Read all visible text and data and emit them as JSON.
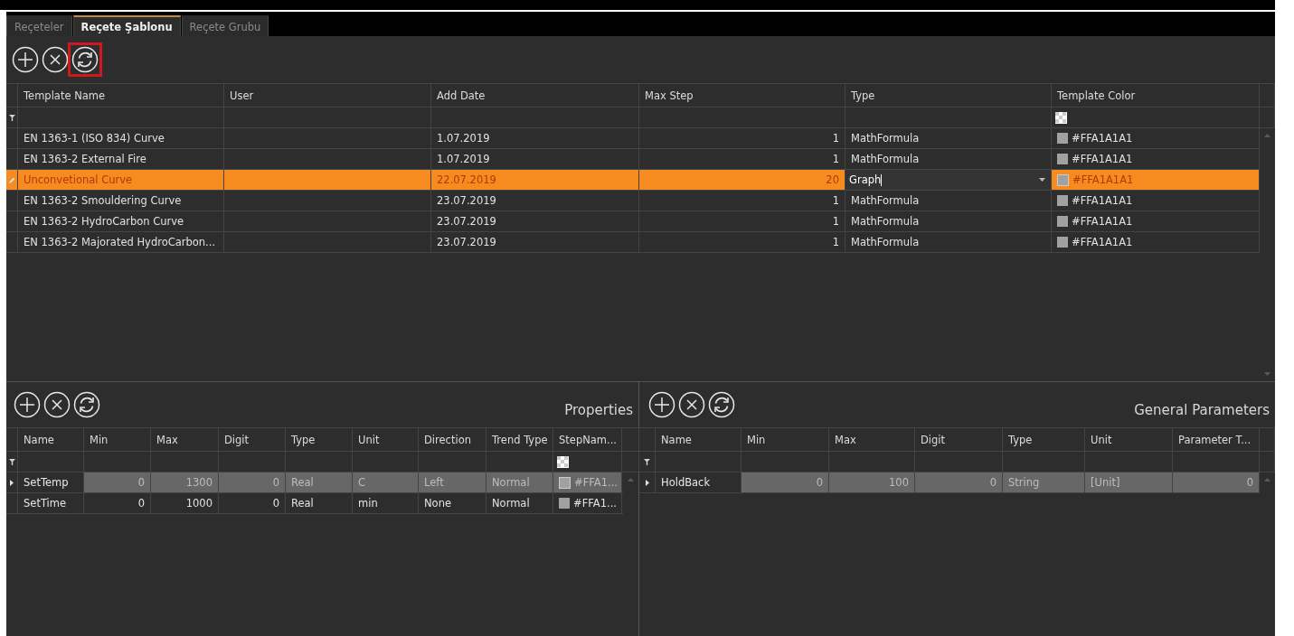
{
  "tabs": [
    {
      "label": "Reçeteler",
      "selected": false
    },
    {
      "label": "Reçete Şablonu",
      "selected": true
    },
    {
      "label": "Reçete Grubu",
      "selected": false
    }
  ],
  "toolbar": {
    "buttons": [
      {
        "kind": "add",
        "highlighted": false
      },
      {
        "kind": "remove",
        "highlighted": false
      },
      {
        "kind": "refresh",
        "highlighted": true
      }
    ]
  },
  "templates_table": {
    "columns": [
      "Template Name",
      "User",
      "Add Date",
      "Max Step",
      "Type",
      "Template Color"
    ],
    "rows": [
      {
        "template_name": "EN 1363-1 (ISO 834) Curve",
        "add_date": "1.07.2019",
        "max_step": "1",
        "type": "MathFormula",
        "template_color": {
          "text": "#FFA1A1A1",
          "color": "#a1a1a1"
        },
        "selected": false,
        "editing": false
      },
      {
        "template_name": "EN 1363-2 External Fire",
        "add_date": "1.07.2019",
        "max_step": "1",
        "type": "MathFormula",
        "template_color": {
          "text": "#FFA1A1A1",
          "color": "#a1a1a1"
        },
        "selected": false,
        "editing": false
      },
      {
        "template_name": "Unconvetional Curve",
        "add_date": "22.07.2019",
        "max_step": "20",
        "type": "Graph",
        "template_color": {
          "text": "#FFA1A1A1",
          "color": "#a1a1a1"
        },
        "selected": true,
        "editing": true
      },
      {
        "template_name": "EN 1363-2 Smouldering Curve",
        "add_date": "23.07.2019",
        "max_step": "1",
        "type": "MathFormula",
        "template_color": {
          "text": "#FFA1A1A1",
          "color": "#a1a1a1"
        },
        "selected": false,
        "editing": false
      },
      {
        "template_name": "EN 1363-2 HydroCarbon Curve",
        "add_date": "23.07.2019",
        "max_step": "1",
        "type": "MathFormula",
        "template_color": {
          "text": "#FFA1A1A1",
          "color": "#a1a1a1"
        },
        "selected": false,
        "editing": false
      },
      {
        "template_name": "EN 1363-2 Majorated HydroCarbon...",
        "add_date": "23.07.2019",
        "max_step": "1",
        "type": "MathFormula",
        "template_color": {
          "text": "#FFA1A1A1",
          "color": "#a1a1a1"
        },
        "selected": false,
        "editing": false
      }
    ]
  },
  "properties": {
    "title": "Properties",
    "buttons": [
      {
        "kind": "add",
        "highlighted": false
      },
      {
        "kind": "remove",
        "highlighted": false
      },
      {
        "kind": "refresh",
        "highlighted": false
      }
    ],
    "columns": [
      "Name",
      "Min",
      "Max",
      "Digit",
      "Type",
      "Unit",
      "Direction",
      "Trend Type",
      "StepNam..."
    ],
    "rows": [
      {
        "name": "SetTemp",
        "min": "0",
        "max": "1300",
        "digit": "0",
        "type": "Real",
        "unit": "C",
        "direction": "Left",
        "trend_type": "Normal",
        "step_name_color": {
          "text": "#FFA1...",
          "color": "#a1a1a1"
        },
        "selected": true
      },
      {
        "name": "SetTime",
        "min": "0",
        "max": "1000",
        "digit": "0",
        "type": "Real",
        "unit": "min",
        "direction": "None",
        "trend_type": "Normal",
        "step_name_color": {
          "text": "#FFA1...",
          "color": "#a1a1a1"
        },
        "selected": false
      }
    ]
  },
  "general_parameters": {
    "title": "General Parameters",
    "buttons": [
      {
        "kind": "add",
        "highlighted": false
      },
      {
        "kind": "remove",
        "highlighted": false
      },
      {
        "kind": "refresh",
        "highlighted": false
      }
    ],
    "columns": [
      "Name",
      "Min",
      "Max",
      "Digit",
      "Type",
      "Unit",
      "Parameter T..."
    ],
    "rows": [
      {
        "name": "HoldBack",
        "min": "0",
        "max": "100",
        "digit": "0",
        "type": "String",
        "unit": "[Unit]",
        "parameter_t": "0",
        "selected": true
      }
    ]
  }
}
